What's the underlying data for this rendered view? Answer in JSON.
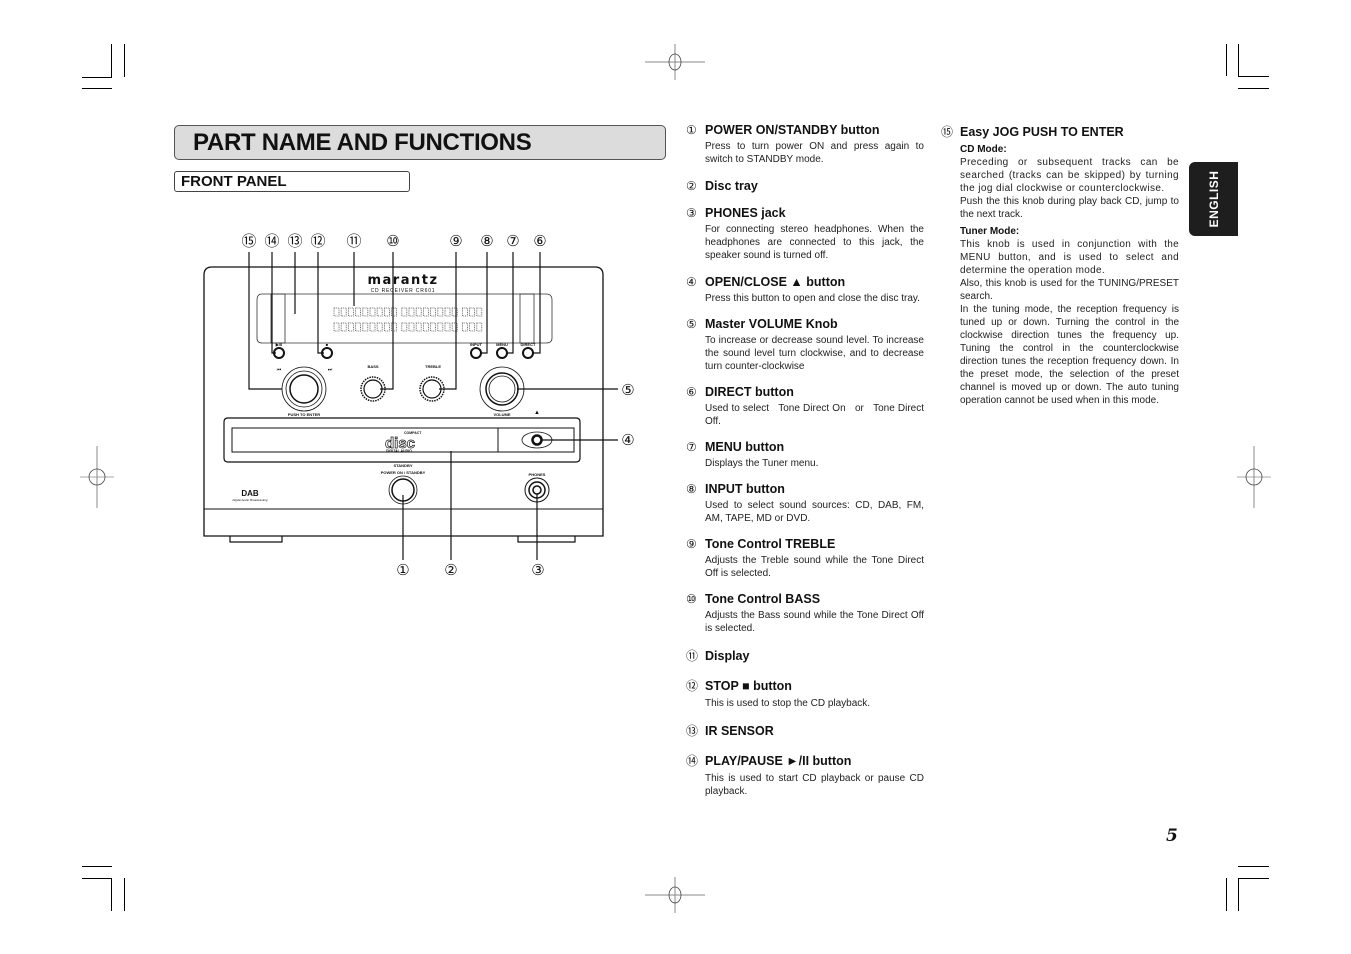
{
  "page": {
    "title": "PART NAME AND FUNCTIONS",
    "section": "FRONT PANEL",
    "language_tab": "ENGLISH",
    "page_number": "5"
  },
  "diagram": {
    "callouts_top": [
      "⑮",
      "⑭",
      "⑬",
      "⑫",
      "⑪",
      "⑩",
      "⑨",
      "⑧",
      "⑦",
      "⑥"
    ],
    "callouts_right": [
      "⑤",
      "④"
    ],
    "callouts_bottom": [
      "①",
      "②",
      "③"
    ],
    "brand": "marantz",
    "model": "CD RECEIVER CR601",
    "button_labels": {
      "play_pause": "▶/II",
      "stop": "■",
      "input": "INPUT",
      "menu": "MENU",
      "direct": "DIRECT",
      "bass": "BASS",
      "treble": "TREBLE",
      "jog": "PUSH TO ENTER",
      "volume": "VOLUME",
      "eject": "▲",
      "standby": "STANDBY",
      "power": "POWER ON / STANDBY",
      "phones": "PHONES",
      "prev": "⏮",
      "next": "⏭"
    },
    "disc_logo": {
      "top": "COMPACT",
      "main": "disc",
      "bottom": "DIGITAL AUDIO"
    },
    "dab_logo": {
      "main": "DAB",
      "sub": "Digital Audio Broadcasting"
    }
  },
  "items_left": [
    {
      "num": "①",
      "title": "POWER ON/STANDBY button",
      "body": "Press to turn power ON and press again to switch to STANDBY mode."
    },
    {
      "num": "②",
      "title": "Disc tray",
      "body": ""
    },
    {
      "num": "③",
      "title": "PHONES jack",
      "body": "For connecting stereo headphones. When the headphones are connected to this jack, the speaker sound is turned off."
    },
    {
      "num": "④",
      "title": "OPEN/CLOSE ▲ button",
      "body": "Press this button to open and close the disc tray."
    },
    {
      "num": "⑤",
      "title": "Master VOLUME Knob",
      "body": "To increase or decrease sound level. To increase the sound level turn clockwise, and to decrease turn counter-clockwise"
    },
    {
      "num": "⑥",
      "title": "DIRECT button",
      "body": "Used to select   Tone Direct On   or   Tone Direct Off."
    },
    {
      "num": "⑦",
      "title": "MENU button",
      "body": "Displays the Tuner menu."
    },
    {
      "num": "⑧",
      "title": "INPUT button",
      "body": "Used to select sound sources: CD, DAB, FM, AM, TAPE, MD or DVD."
    },
    {
      "num": "⑨",
      "title": "Tone Control TREBLE",
      "body": "Adjusts the Treble sound while the Tone Direct Off is selected."
    },
    {
      "num": "⑩",
      "title": "Tone Control BASS",
      "body": "Adjusts the Bass sound while the Tone Direct Off is selected."
    },
    {
      "num": "⑪",
      "title": "Display",
      "body": ""
    },
    {
      "num": "⑫",
      "title": "STOP ■ button",
      "body": "This is used to stop the CD playback."
    },
    {
      "num": "⑬",
      "title": "IR SENSOR",
      "body": ""
    },
    {
      "num": "⑭",
      "title": "PLAY/PAUSE ►/II button",
      "body": "This is used to start CD playback or pause CD playback."
    }
  ],
  "item_right": {
    "num": "⑮",
    "title": "Easy JOG PUSH TO ENTER",
    "cd_mode": {
      "heading": "CD Mode:",
      "paragraphs": [
        "Preceding or subsequent tracks can be searched (tracks can be skipped) by turning the jog dial clockwise or counterclockwise.",
        "Push the this knob during play back CD, jump to the next track."
      ]
    },
    "tuner_mode": {
      "heading": "Tuner Mode:",
      "paragraphs": [
        "This knob is used in conjunction with the MENU button, and is used to select and determine the operation mode.",
        "Also, this knob is used for the TUNING/PRESET search.",
        "In the tuning mode, the reception frequency is tuned up or down. Turning the control in the clockwise direction tunes the frequency up. Tuning the control in the counterclockwise direction tunes the reception frequency down. In the preset mode, the selection of the preset channel is moved up or down. The auto tuning operation cannot be used when in this mode."
      ]
    }
  }
}
